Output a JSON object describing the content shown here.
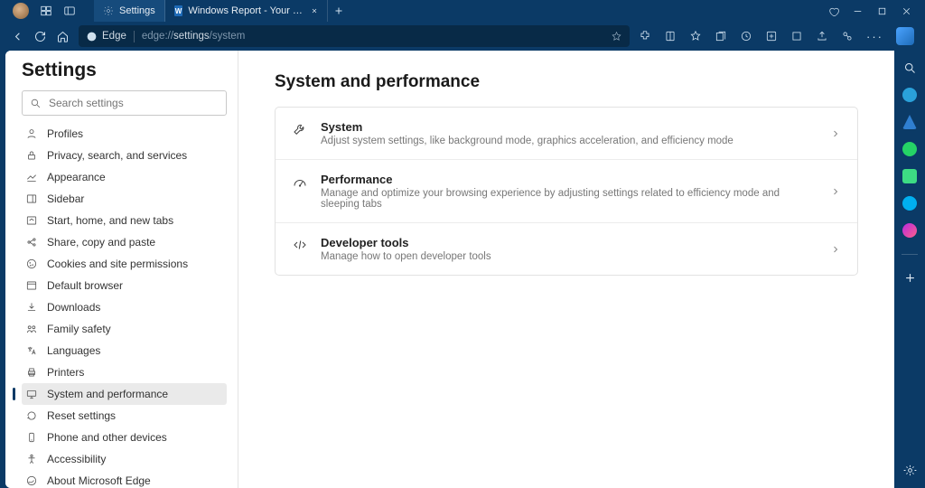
{
  "titlebar": {
    "tabs": [
      {
        "label": "Settings",
        "icon": "gear",
        "active": true
      },
      {
        "label": "Windows Report - Your go-to sou",
        "icon": "wr",
        "active": false
      }
    ]
  },
  "toolbar": {
    "pill_label": "Edge",
    "url_prefix": "edge://",
    "url_mid": "settings",
    "url_suffix": "/system"
  },
  "sidebar": {
    "heading": "Settings",
    "search_placeholder": "Search settings",
    "items": [
      {
        "label": "Profiles",
        "icon": "profile"
      },
      {
        "label": "Privacy, search, and services",
        "icon": "lock"
      },
      {
        "label": "Appearance",
        "icon": "appearance"
      },
      {
        "label": "Sidebar",
        "icon": "sidebar"
      },
      {
        "label": "Start, home, and new tabs",
        "icon": "home"
      },
      {
        "label": "Share, copy and paste",
        "icon": "share"
      },
      {
        "label": "Cookies and site permissions",
        "icon": "cookie"
      },
      {
        "label": "Default browser",
        "icon": "browser"
      },
      {
        "label": "Downloads",
        "icon": "download"
      },
      {
        "label": "Family safety",
        "icon": "family"
      },
      {
        "label": "Languages",
        "icon": "lang"
      },
      {
        "label": "Printers",
        "icon": "printer"
      },
      {
        "label": "System and performance",
        "icon": "system",
        "active": true
      },
      {
        "label": "Reset settings",
        "icon": "reset"
      },
      {
        "label": "Phone and other devices",
        "icon": "phone"
      },
      {
        "label": "Accessibility",
        "icon": "accessibility"
      },
      {
        "label": "About Microsoft Edge",
        "icon": "edge"
      }
    ]
  },
  "main": {
    "heading": "System and performance",
    "rows": [
      {
        "title": "System",
        "desc": "Adjust system settings, like background mode, graphics acceleration, and efficiency mode",
        "icon": "wrench"
      },
      {
        "title": "Performance",
        "desc": "Manage and optimize your browsing experience by adjusting settings related to efficiency mode and sleeping tabs",
        "icon": "perf"
      },
      {
        "title": "Developer tools",
        "desc": "Manage how to open developer tools",
        "icon": "dev"
      }
    ]
  },
  "rightrail": {
    "items": [
      {
        "name": "search",
        "type": "svg"
      },
      {
        "name": "telegram",
        "color": "#2aa1da"
      },
      {
        "name": "bing",
        "color": "#2f7fd1"
      },
      {
        "name": "whatsapp",
        "color": "#25d366"
      },
      {
        "name": "android",
        "color": "#3ddc84"
      },
      {
        "name": "skype",
        "color": "#00aff0"
      },
      {
        "name": "messenger",
        "color": "#b72adf"
      }
    ]
  }
}
